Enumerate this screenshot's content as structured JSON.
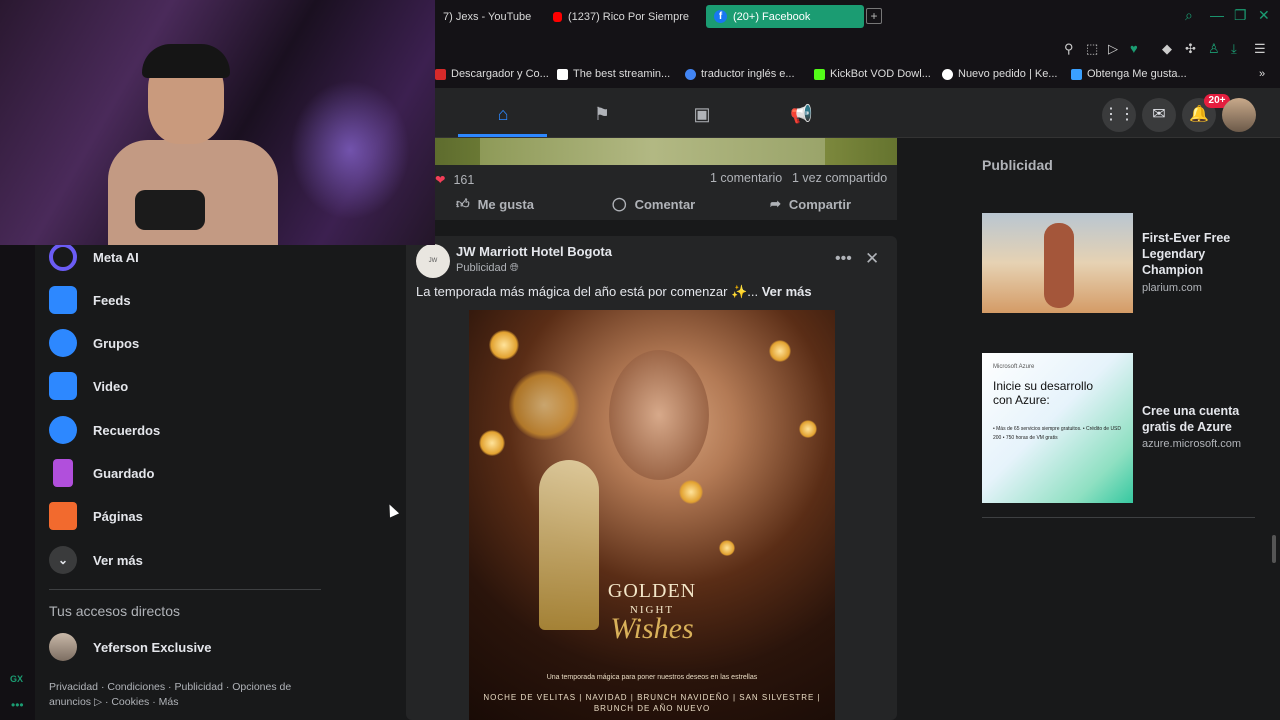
{
  "tabs": [
    {
      "label": "7) Jexs - YouTube"
    },
    {
      "label": "(1237) Rico Por Siempre"
    },
    {
      "label": "(20+) Facebook"
    }
  ],
  "bookmarks": [
    {
      "label": "Descargador y Co...",
      "color": "#d62a2a"
    },
    {
      "label": "The best streamin...",
      "color": "#ffffff"
    },
    {
      "label": "traductor inglés e...",
      "color": "#4285f4"
    },
    {
      "label": "KickBot VOD Dowl...",
      "color": "#53fc18"
    },
    {
      "label": "Nuevo pedido | Ke...",
      "color": "#ffffff"
    },
    {
      "label": "Obtenga Me gusta...",
      "color": "#3aa0ff"
    }
  ],
  "nav": {
    "notif_badge": "20+"
  },
  "sidebar": {
    "items": [
      {
        "label": "Meta AI",
        "icon": "meta-ai-icon",
        "color": "#6b5cf5"
      },
      {
        "label": "Feeds",
        "icon": "feeds-icon",
        "color": "#2d88ff"
      },
      {
        "label": "Grupos",
        "icon": "groups-icon",
        "color": "#2d88ff"
      },
      {
        "label": "Video",
        "icon": "video-icon",
        "color": "#2d88ff"
      },
      {
        "label": "Recuerdos",
        "icon": "memories-icon",
        "color": "#2d88ff"
      },
      {
        "label": "Guardado",
        "icon": "saved-icon",
        "color": "#b14fdc"
      },
      {
        "label": "Páginas",
        "icon": "pages-icon",
        "color": "#f26a2e"
      },
      {
        "label": "Ver más",
        "icon": "chevron-down-icon",
        "color": "#3a3b3c"
      }
    ],
    "shortcuts_title": "Tus accesos directos",
    "shortcut_name": "Yeferson Exclusive",
    "footer_line1": "Privacidad · Condiciones · Publicidad · Opciones de",
    "footer_line2": "anuncios ▷ · Cookies · Más"
  },
  "post1": {
    "reactions": "161",
    "comments": "1 comentario",
    "shares": "1 vez compartido",
    "like_label": "Me gusta",
    "comment_label": "Comentar",
    "share_label": "Compartir"
  },
  "post2": {
    "author": "JW Marriott Hotel Bogota",
    "sponsored": "Publicidad",
    "text": "La temporada más mágica del año está por comenzar ✨...",
    "see_more": "Ver más",
    "image_title1": "GOLDEN",
    "image_title2": "NIGHT",
    "image_title3": "Wishes",
    "image_tagline": "Una temporada mágica para poner nuestros deseos en las estrellas",
    "image_events1": "NOCHE DE VELITAS | NAVIDAD | BRUNCH NAVIDEÑO | SAN SILVESTRE |",
    "image_events2": "BRUNCH DE AÑO NUEVO"
  },
  "ads": {
    "title": "Publicidad",
    "ad1": {
      "title": "First-Ever Free Legendary Champion",
      "source": "plarium.com"
    },
    "ad2": {
      "title": "Cree una cuenta gratis de Azure",
      "source": "azure.microsoft.com",
      "img_brand": "Microsoft Azure",
      "img_heading": "Inicie su desarrollo con Azure:",
      "img_bullets": "• Más de 65 servicios siempre gratuitos. • Crédito de USD 200 • 750 horas de VM gratis"
    }
  },
  "gx_label": "GX"
}
